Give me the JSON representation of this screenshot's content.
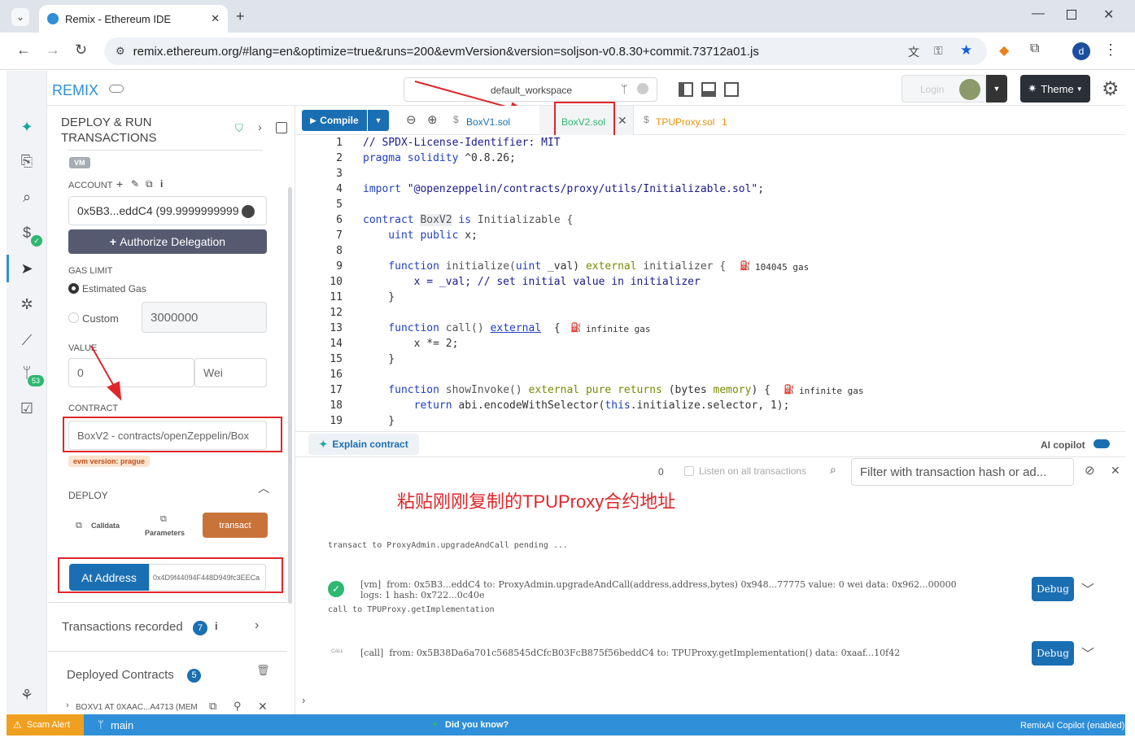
{
  "browser": {
    "tab_title": "Remix - Ethereum IDE",
    "url": "remix.ethereum.org/#lang=en&optimize=true&runs=200&evmVersion&version=soljson-v0.8.30+commit.73712a01.js",
    "profile_letter": "d"
  },
  "topbar": {
    "brand": "REMIX",
    "workspace": "default_workspace",
    "theme_label": "Theme",
    "login_label": "Login"
  },
  "icon_panel": {
    "git_badge": "53",
    "ai_icon": "ai-icon"
  },
  "side": {
    "title_line1": "DEPLOY & RUN",
    "title_line2": "TRANSACTIONS",
    "env_badge": "VM",
    "account_label": "ACCOUNT",
    "account_value": "0x5B3...eddC4 (99.9999999999",
    "authorize_label": "Authorize Delegation",
    "gas_limit_label": "GAS LIMIT",
    "estimated_gas_label": "Estimated Gas",
    "custom_label": "Custom",
    "custom_gas_value": "3000000",
    "value_label": "VALUE",
    "value_amount": "0",
    "value_unit": "Wei",
    "contract_label": "CONTRACT",
    "contract_value": "BoxV2 - contracts/openZeppelin/Box",
    "evm_badge": "evm version: prague",
    "deploy_label": "DEPLOY",
    "calldata_label": "Calldata",
    "parameters_label": "Parameters",
    "transact_label": "transact",
    "at_address_label": "At Address",
    "at_address_value": "0x4D9f44094F448D949fc3EECa",
    "tx_recorded_label": "Transactions recorded",
    "tx_recorded_count": "7",
    "deployed_label": "Deployed Contracts",
    "deployed_count": "5",
    "deployed_item": "BOXV1 AT 0XAAC...A4713 (MEM"
  },
  "editor": {
    "compile_label": "Compile",
    "tabs": [
      {
        "label": "BoxV1.sol"
      },
      {
        "label": "BoxV2.sol"
      },
      {
        "label": "TPUProxy.sol",
        "count": "1"
      }
    ],
    "line_numbers": [
      "1",
      "2",
      "3",
      "4",
      "5",
      "6",
      "7",
      "8",
      "9",
      "10",
      "11",
      "12",
      "13",
      "14",
      "15",
      "16",
      "17",
      "18",
      "19"
    ],
    "gas_hints": [
      "104045 gas",
      "infinite gas",
      "infinite gas"
    ]
  },
  "code": {
    "l1": "// SPDX-License-Identifier: MIT",
    "l2a": "pragma solidity",
    "l2b": " ^0.8.26;",
    "l4a": "import ",
    "l4b": "\"@openzeppelin/contracts/proxy/utils/Initializable.sol\"",
    "l4c": ";",
    "l6a": "contract ",
    "l6b": "BoxV2",
    "l6c": " is ",
    "l6d": "Initializable {",
    "l7a": "    uint ",
    "l7b": "public",
    "l7c": " x;",
    "l9a": "    function ",
    "l9b": "initialize(",
    "l9c": "uint",
    "l9d": " _val) ",
    "l9e": "external",
    "l9f": " initializer {",
    "l10": "        x = _val; // set initial value in initializer",
    "l11": "    }",
    "l13a": "    function ",
    "l13b": "call() ",
    "l13c": "external",
    "l13d": "  {",
    "l14": "        x *= 2;",
    "l15": "    }",
    "l17a": "    function ",
    "l17b": "showInvoke() ",
    "l17c": "external pure returns",
    "l17d": " (bytes ",
    "l17e": "memory",
    "l17f": ") {",
    "l18a": "        return ",
    "l18b": "abi.encodeWithSelector(",
    "l18c": "this",
    "l18d": ".initialize.selector, 1);",
    "l19": "    }"
  },
  "terminal": {
    "explain_label": "Explain contract",
    "ai_copilot_label": "AI copilot",
    "count": "0",
    "listen_label": "Listen on all transactions",
    "filter_placeholder": "Filter with transaction hash or ad...",
    "annotation": "粘贴刚刚复制的TPUProxy合约地址",
    "pending": "transact to ProxyAdmin.upgradeAndCall pending ...",
    "tx1_line1": "[vm]  from: 0x5B3...eddC4 to: ProxyAdmin.upgradeAndCall(address,address,bytes) 0x948...77775 value: 0 wei data: 0x962...00000",
    "tx1_line2": "logs: 1 hash: 0x722...0c40e",
    "call_line": "call to TPUProxy.getImplementation",
    "call_tag": "CALL",
    "tx2_line": "[call]  from: 0x5B38Da6a701c568545dCfcB03FcB875f56beddC4 to: TPUProxy.getImplementation() data: 0xaaf...10f42",
    "debug_label": "Debug"
  },
  "status": {
    "scam_label": "Scam Alert",
    "branch": "main",
    "did_you_know": "Did you know?",
    "copilot": "RemixAI Copilot (enabled)"
  },
  "colors": {
    "accent": "#2f8fd8",
    "compile": "#1a6fb3",
    "transact": "#c8733a",
    "annotation_red": "#e0262a",
    "tab_orange": "#e8920c"
  }
}
